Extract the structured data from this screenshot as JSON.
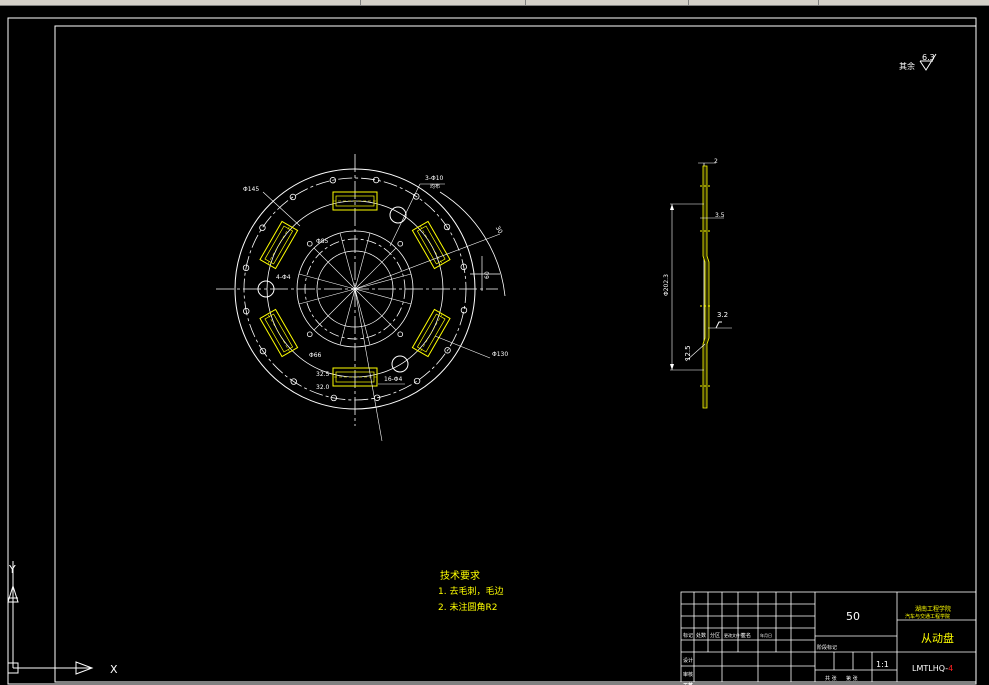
{
  "surface_finish_note": {
    "label": "其余",
    "value": "6.3"
  },
  "front_view": {
    "labels": {
      "outer_dia": "Φ145",
      "holes_3": "3-Φ10",
      "holes_3_sub": "均布",
      "inner_dia": "Φ85",
      "holes_4": "4-Φ4",
      "dia_66": "Φ66",
      "dia_130": "Φ130",
      "dim_30": "30",
      "dim_60": "60",
      "dim_325": "32.5",
      "dim_320": "32.0",
      "holes_16": "16-Φ4"
    }
  },
  "side_view": {
    "labels": {
      "thickness_top": "2",
      "dim_35": "3.5",
      "diameter": "Φ202.3",
      "roughness_a": "3.2",
      "roughness_b": "12.5"
    }
  },
  "technical_requirements": {
    "title": "技术要求",
    "items": [
      "1. 去毛刺，毛边",
      "2. 未注圆角R2"
    ]
  },
  "title_block": {
    "scale_box": "50",
    "school_line1": "湖南工程学院",
    "school_line2": "汽车与交通工程学院",
    "part_name": "从动盘",
    "drawing_no_prefix": "LMTLHQ-",
    "drawing_no_suffix": "4",
    "scale": "1:1",
    "row_labels": [
      "标记",
      "处数",
      "分区",
      "更改文件号",
      "签名",
      "年月日"
    ],
    "design": "设计",
    "check": "审核",
    "process": "工艺",
    "stage_mark": "阶段标记",
    "sheets_total": "共 张",
    "sheet_no": "第 张"
  },
  "ucs": {
    "x": "X",
    "y": "Y"
  },
  "colors": {
    "line": "#ffffff",
    "yellow": "#ffff00",
    "red": "#ff2020",
    "bg": "#000000"
  }
}
